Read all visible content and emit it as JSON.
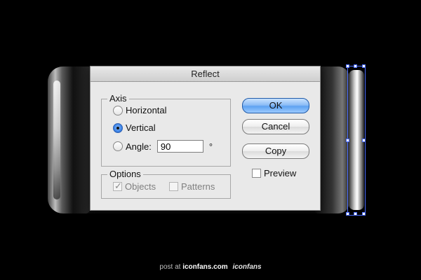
{
  "dialog": {
    "title": "Reflect",
    "axis": {
      "legend": "Axis",
      "options": [
        {
          "label": "Horizontal",
          "selected": false
        },
        {
          "label": "Vertical",
          "selected": true
        },
        {
          "label": "Angle:",
          "selected": false
        }
      ],
      "angle_value": "90",
      "degree_symbol": "°"
    },
    "options_group": {
      "legend": "Options",
      "objects_label": "Objects",
      "objects_checked": true,
      "patterns_label": "Patterns",
      "patterns_checked": false
    },
    "buttons": {
      "ok": "OK",
      "cancel": "Cancel",
      "copy": "Copy"
    },
    "preview_label": "Preview",
    "preview_checked": false
  },
  "footer": {
    "prefix": "post at",
    "site": "iconfans.com",
    "brand": "iconfans"
  },
  "colors": {
    "selection_blue": "#4a6cff",
    "ok_button_blue": "#5ea2f1"
  }
}
